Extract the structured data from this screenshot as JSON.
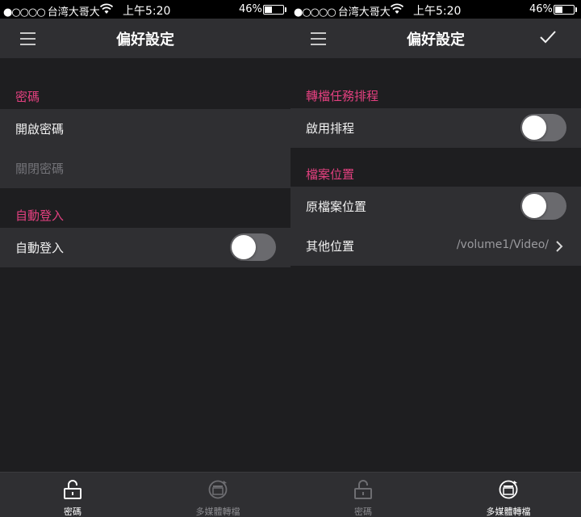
{
  "status_bar": {
    "carrier": "台湾大哥大",
    "time": "上午5:20",
    "battery": "46%",
    "battery_level": 0.46
  },
  "left_screen": {
    "title": "偏好設定",
    "section_password": {
      "header": "密碼"
    },
    "row_enable_password": {
      "label": "開啟密碼"
    },
    "row_disable_password": {
      "label": "關閉密碼"
    },
    "section_autologin": {
      "header": "自動登入"
    },
    "row_autologin": {
      "label": "自動登入",
      "toggle_on": false
    }
  },
  "right_screen": {
    "title": "偏好設定",
    "section_schedule": {
      "header": "轉檔任務排程"
    },
    "row_enable_schedule": {
      "label": "啟用排程",
      "toggle_on": false
    },
    "section_location": {
      "header": "檔案位置"
    },
    "row_original_location": {
      "label": "原檔案位置",
      "toggle_on": false
    },
    "row_other_location": {
      "label": "其他位置",
      "value": "/volume1/Video/"
    }
  },
  "tab_bar": {
    "tab_password": {
      "label": "密碼"
    },
    "tab_transcode": {
      "label": "多媒體轉檔"
    }
  },
  "left_active_tab": "tab_password",
  "right_active_tab": "tab_transcode",
  "colors": {
    "accent_pink": "#e2407f",
    "row_bg": "#2f2f32",
    "page_bg": "#1e1e20"
  }
}
